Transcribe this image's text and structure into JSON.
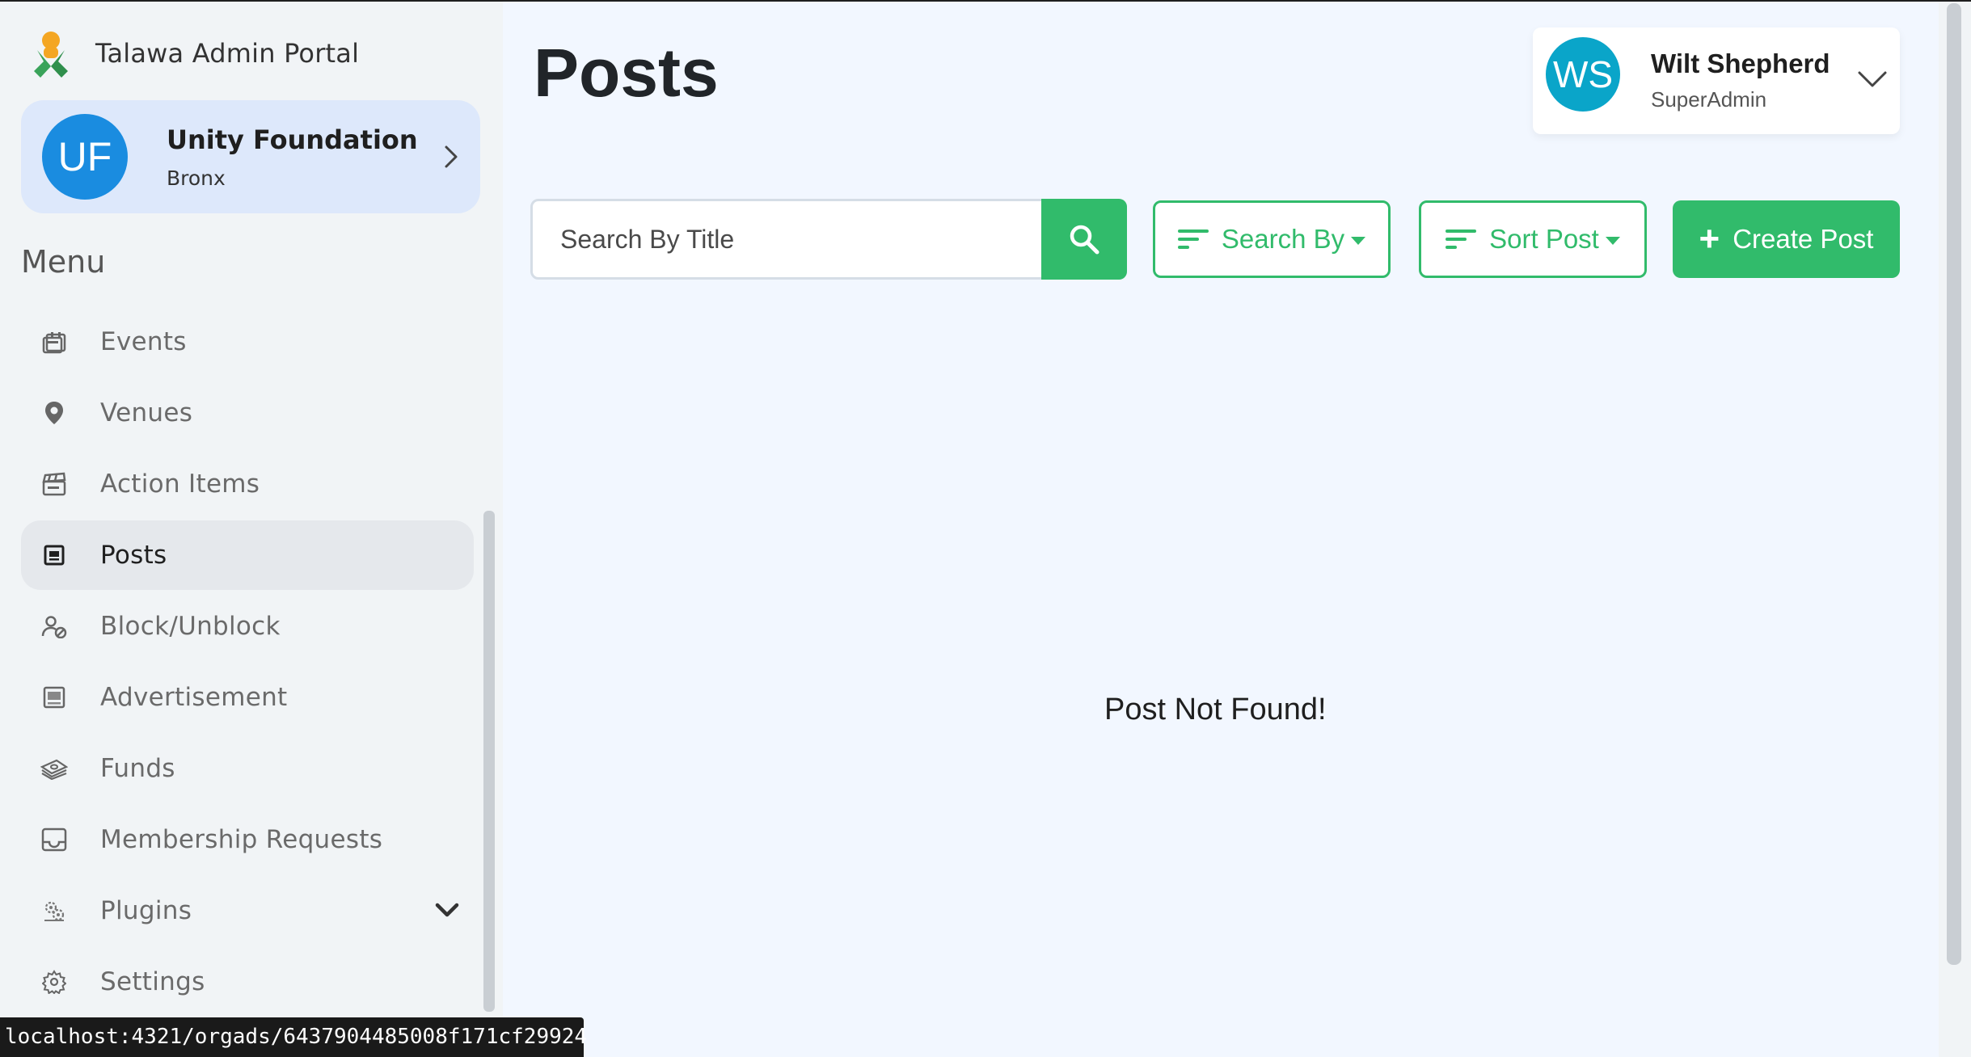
{
  "app": {
    "brand_name": "Talawa Admin Portal"
  },
  "organization": {
    "initials": "UF",
    "name": "Unity Foundation",
    "city": "Bronx"
  },
  "sidebar": {
    "menu_title": "Menu",
    "items": [
      {
        "label": "Events",
        "icon": "calendar-icon",
        "active": false
      },
      {
        "label": "Venues",
        "icon": "location-pin-icon",
        "active": false
      },
      {
        "label": "Action Items",
        "icon": "clapperboard-icon",
        "active": false
      },
      {
        "label": "Posts",
        "icon": "post-icon",
        "active": true
      },
      {
        "label": "Block/Unblock",
        "icon": "block-user-icon",
        "active": false
      },
      {
        "label": "Advertisement",
        "icon": "advertisement-icon",
        "active": false
      },
      {
        "label": "Funds",
        "icon": "money-stack-icon",
        "active": false
      },
      {
        "label": "Membership Requests",
        "icon": "inbox-icon",
        "active": false
      },
      {
        "label": "Plugins",
        "icon": "plugin-icon",
        "active": false,
        "expandable": true
      },
      {
        "label": "Settings",
        "icon": "gear-icon",
        "active": false
      }
    ]
  },
  "main": {
    "title": "Posts",
    "search": {
      "placeholder": "Search By Title",
      "value": ""
    },
    "search_by_label": "Search By",
    "sort_post_label": "Sort Post",
    "create_post_label": "Create Post",
    "empty_message": "Post Not Found!"
  },
  "user": {
    "initials": "WS",
    "name": "Wilt Shepherd",
    "role": "SuperAdmin"
  },
  "status_bar": {
    "url": "localhost:4321/orgads/6437904485008f171cf29924"
  },
  "colors": {
    "accent_green": "#31bb6b",
    "org_avatar_blue": "#1a8ce0",
    "user_avatar_cyan": "#0aa5c9",
    "org_card_bg": "#dde8fb",
    "page_bg": "#f2f7ff"
  }
}
